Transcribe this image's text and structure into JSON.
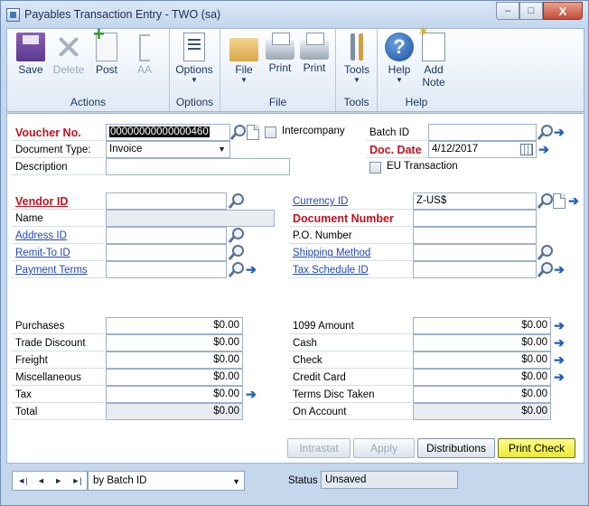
{
  "window": {
    "title": "Payables Transaction Entry  -  TWO (sa)",
    "min": "–",
    "max": "□",
    "close": "X"
  },
  "ribbon": {
    "groups": {
      "actions": "Actions",
      "options": "Options",
      "file": "File",
      "tools": "Tools",
      "help": "Help"
    },
    "buttons": {
      "save": "Save",
      "delete": "Delete",
      "post": "Post",
      "aa": "AA",
      "options": "Options",
      "file": "File",
      "print1": "Print",
      "print2": "Print",
      "tools": "Tools",
      "help": "Help",
      "add_note_1": "Add",
      "add_note_2": "Note",
      "help_glyph": "?"
    }
  },
  "header": {
    "voucher_label": "Voucher No.",
    "voucher_value": "00000000000000460",
    "intercompany_label": "Intercompany",
    "batch_label": "Batch ID",
    "batch_value": "",
    "doc_type_label": "Document Type:",
    "doc_type_value": "Invoice",
    "doc_date_label": "Doc. Date",
    "doc_date_value": "4/12/2017",
    "description_label": "Description",
    "description_value": "",
    "eu_label": "EU Transaction"
  },
  "vendor": {
    "vendor_id_label": "Vendor ID",
    "vendor_id_value": "",
    "name_label": "Name",
    "name_value": "",
    "address_label": "Address ID",
    "address_value": "",
    "remit_label": "Remit-To ID",
    "remit_value": "",
    "payment_terms_label": "Payment Terms",
    "payment_terms_value": ""
  },
  "right_info": {
    "currency_label": "Currency ID",
    "currency_value": "Z-US$",
    "doc_number_label": "Document Number",
    "doc_number_value": "",
    "po_label": "P.O. Number",
    "po_value": "",
    "shipping_label": "Shipping Method",
    "shipping_value": "",
    "tax_schedule_label": "Tax Schedule ID",
    "tax_schedule_value": ""
  },
  "amounts_left": [
    {
      "label": "Purchases",
      "value": "$0.00"
    },
    {
      "label": "Trade Discount",
      "value": "$0.00"
    },
    {
      "label": "Freight",
      "value": "$0.00"
    },
    {
      "label": "Miscellaneous",
      "value": "$0.00"
    },
    {
      "label": "Tax",
      "value": "$0.00"
    },
    {
      "label": "Total",
      "value": "$0.00"
    }
  ],
  "amounts_right": [
    {
      "label": "1099 Amount",
      "value": "$0.00"
    },
    {
      "label": "Cash",
      "value": "$0.00"
    },
    {
      "label": "Check",
      "value": "$0.00"
    },
    {
      "label": "Credit Card",
      "value": "$0.00"
    },
    {
      "label": "Terms Disc Taken",
      "value": "$0.00"
    },
    {
      "label": "On Account",
      "value": "$0.00"
    }
  ],
  "buttons": {
    "intrastat": "Intrastat",
    "apply": "Apply",
    "distributions": "Distributions",
    "print_check": "Print Check"
  },
  "footer": {
    "nav_first": "◄|",
    "nav_prev": "◄",
    "nav_next": "►",
    "nav_last": "►|",
    "sort_value": "by Batch ID",
    "status_label": "Status",
    "status_value": "Unsaved"
  },
  "glyphs": {
    "arrow": "➔",
    "dropdown": "▼"
  },
  "colors": {
    "required": "#c1121f",
    "link": "#1f47b8",
    "highlight": "#f6f078",
    "primary_button": "#ecea39"
  }
}
